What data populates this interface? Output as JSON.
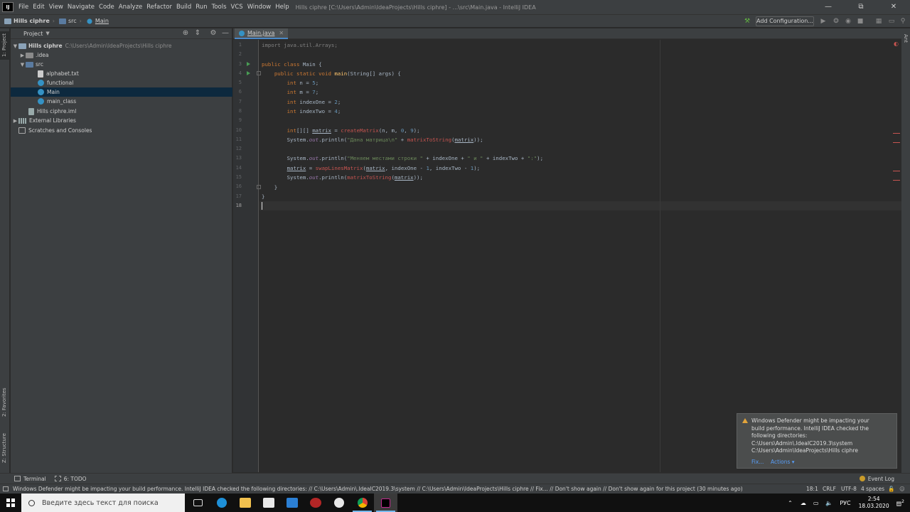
{
  "menubar": {
    "items": [
      "File",
      "Edit",
      "View",
      "Navigate",
      "Code",
      "Analyze",
      "Refactor",
      "Build",
      "Run",
      "Tools",
      "VCS",
      "Window",
      "Help"
    ],
    "window_title": "Hills ciphre [C:\\Users\\Admin\\IdeaProjects\\Hills ciphre] - ...\\src\\Main.java - IntelliJ IDEA"
  },
  "navbar": {
    "project": "Hills ciphre",
    "folder": "src",
    "file": "Main",
    "add_configuration": "Add Configuration..."
  },
  "left_stripe": {
    "project_tab": "1: Project",
    "favorites_tab": "2: Favorites",
    "structure_tab": "Z: Structure"
  },
  "project_panel": {
    "title": "Project",
    "tree": [
      {
        "label": "Hills ciphre",
        "path": "C:\\Users\\Admin\\IdeaProjects\\Hills ciphre"
      },
      {
        "label": ".idea"
      },
      {
        "label": "src"
      },
      {
        "label": "alphabet.txt"
      },
      {
        "label": "functional"
      },
      {
        "label": "Main"
      },
      {
        "label": "main_class"
      },
      {
        "label": "Hills ciphre.iml"
      },
      {
        "label": "External Libraries"
      },
      {
        "label": "Scratches and Consoles"
      }
    ]
  },
  "editor": {
    "tab": "Main.java",
    "line_numbers": [
      "1",
      "2",
      "3",
      "4",
      "5",
      "6",
      "7",
      "8",
      "9",
      "10",
      "11",
      "12",
      "13",
      "14",
      "15",
      "16",
      "17",
      "18"
    ],
    "current_line": "18"
  },
  "right_stripe": {
    "ant_tab": "Ant"
  },
  "bottom_tools": {
    "terminal": "Terminal",
    "todo": "6: TODO",
    "event_log": "Event Log"
  },
  "status": {
    "message": "Windows Defender might be impacting your build performance. IntelliJ IDEA checked the following directories: // C:\\Users\\Admin\\.IdeaIC2019.3\\system // C:\\Users\\Admin\\IdeaProjects\\Hills ciphre // Fix... // Don't show again // Don't show again for this project (30 minutes ago)",
    "position": "18:1",
    "line_separator": "CRLF",
    "encoding": "UTF-8",
    "indent": "4 spaces"
  },
  "notification": {
    "lines": [
      "Windows Defender might be impacting your",
      "build performance. IntelliJ IDEA checked the",
      "following directories:",
      "C:\\Users\\Admin\\.IdeaIC2019.3\\system",
      "C:\\Users\\Admin\\IdeaProjects\\Hills ciphre"
    ],
    "fix": "Fix...",
    "actions": "Actions ▾"
  },
  "taskbar": {
    "search_placeholder": "Введите здесь текст для поиска",
    "language": "РУС",
    "time": "2:54",
    "date": "18.03.2020",
    "notifications_count": "2"
  },
  "colors": {
    "editor_bg": "#2b2b2b",
    "panel_bg": "#3c3f41",
    "keyword": "#cc7832",
    "string": "#6a8759",
    "number": "#6897bb",
    "selection": "#0d293e",
    "link": "#589df6"
  }
}
